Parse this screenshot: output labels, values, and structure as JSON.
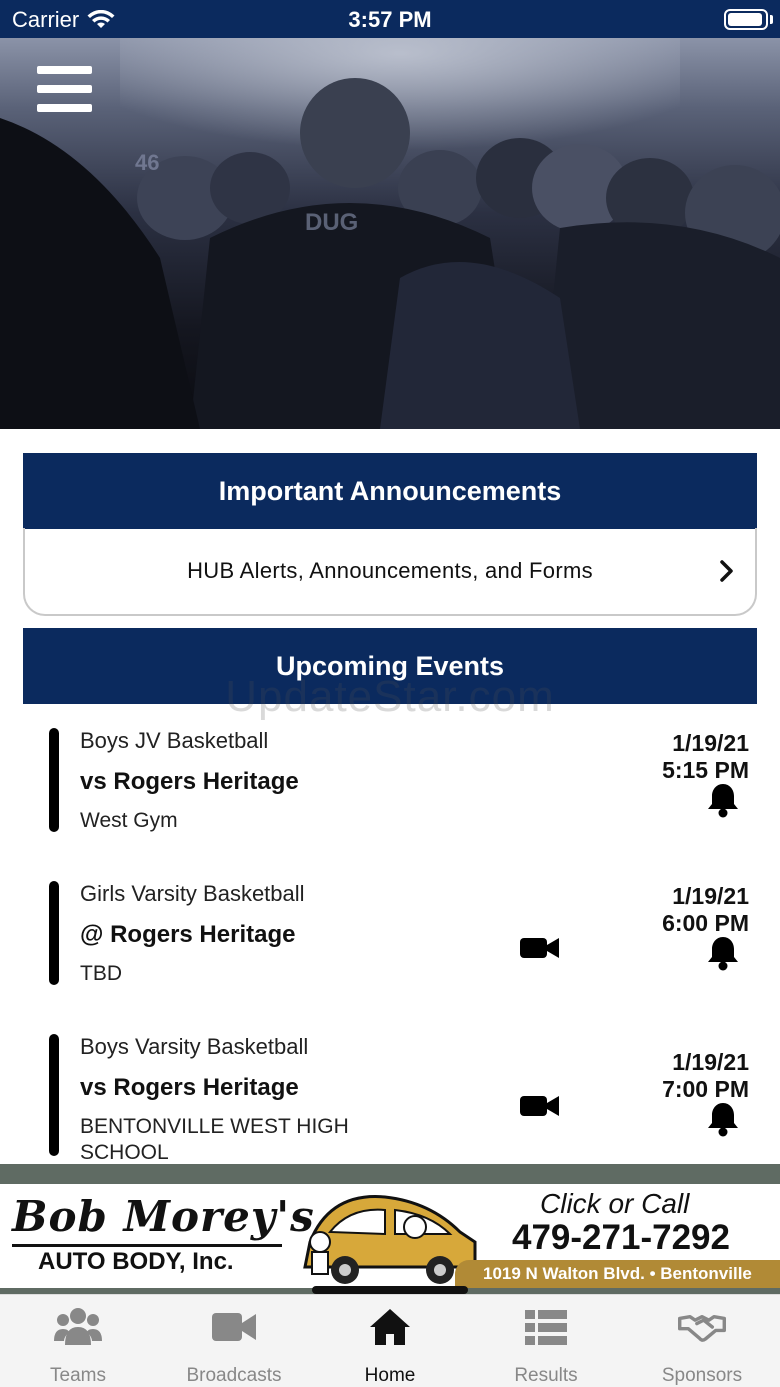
{
  "status_bar": {
    "carrier": "Carrier",
    "time": "3:57 PM"
  },
  "hero": {
    "menu_icon": "hamburger-menu-icon"
  },
  "announcements": {
    "title": "Important Announcements",
    "row_label": "HUB Alerts, Announcements, and Forms"
  },
  "events": {
    "title": "Upcoming Events",
    "items": [
      {
        "sport": "Boys JV Basketball",
        "opponent": "vs Rogers Heritage",
        "location": "West Gym",
        "date": "1/19/21",
        "time": "5:15 PM",
        "has_video": false
      },
      {
        "sport": "Girls Varsity Basketball",
        "opponent": "@ Rogers Heritage",
        "location": "TBD",
        "date": "1/19/21",
        "time": "6:00 PM",
        "has_video": true
      },
      {
        "sport": "Boys Varsity Basketball",
        "opponent": "vs Rogers Heritage",
        "location": "BENTONVILLE WEST HIGH SCHOOL",
        "date": "1/19/21",
        "time": "7:00 PM",
        "has_video": true
      }
    ]
  },
  "watermark": "UpdateStar.com",
  "ad": {
    "brand": "Bob Morey's",
    "subtitle": "AUTO BODY, Inc.",
    "cta": "Click or Call",
    "phone": "479-271-7292",
    "address": "1019 N Walton Blvd. • Bentonville"
  },
  "tabs": [
    {
      "label": "Teams",
      "icon": "users-icon",
      "active": false
    },
    {
      "label": "Broadcasts",
      "icon": "video-camera-icon",
      "active": false
    },
    {
      "label": "Home",
      "icon": "home-icon",
      "active": true
    },
    {
      "label": "Results",
      "icon": "list-icon",
      "active": false
    },
    {
      "label": "Sponsors",
      "icon": "handshake-icon",
      "active": false
    }
  ],
  "colors": {
    "primary": "#0b2a5e",
    "tab_inactive": "#888888",
    "tab_active": "#111111",
    "ad_gold": "#b18a36"
  }
}
